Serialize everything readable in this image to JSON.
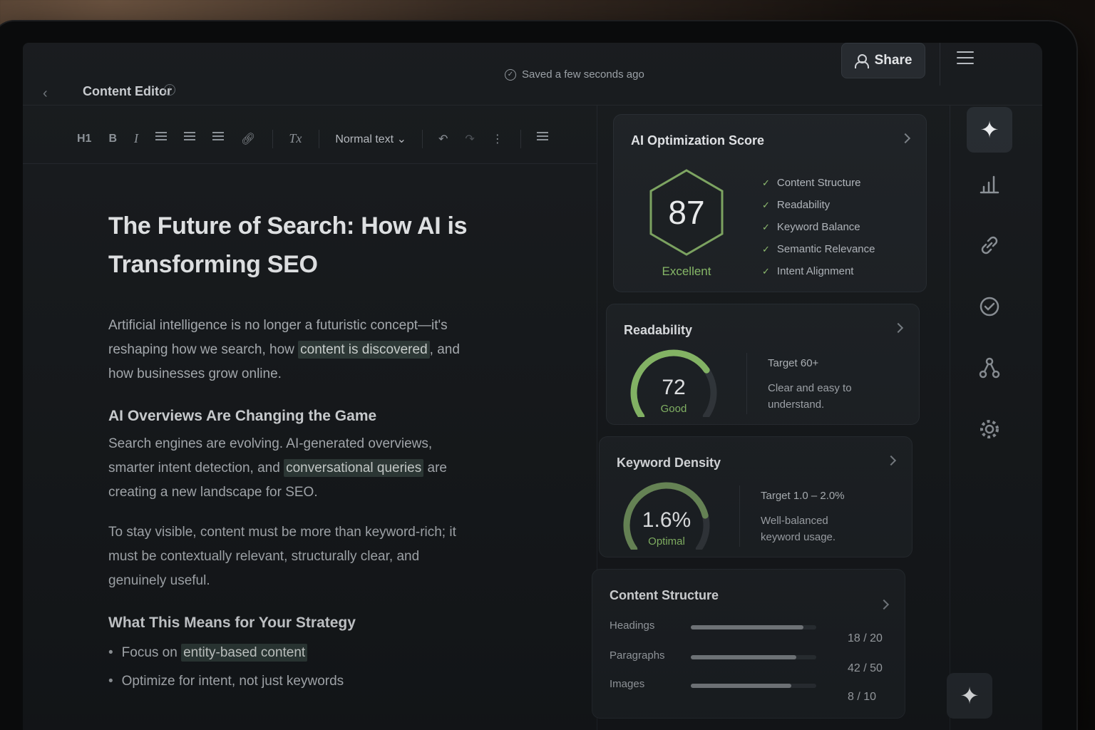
{
  "header": {
    "title": "Content Editor",
    "saved_status": "Saved a few seconds ago",
    "share_label": "Share"
  },
  "toolbar": {
    "heading": "H1",
    "bold": "B",
    "italic": "I",
    "clear_format": "Tx",
    "text_style": "Normal text",
    "more": "⋮"
  },
  "document": {
    "title": "The Future of Search: How AI is Transforming SEO",
    "intro_before": "Artificial intelligence is no longer a futuristic concept—it's reshaping how we search, how ",
    "intro_highlight": "content is discovered",
    "intro_after": ", and how businesses grow online.",
    "section1_heading": "AI Overviews Are Changing the Game",
    "section1_p1_before": "Search engines are evolving. AI-generated overviews, smarter intent detection, and ",
    "section1_p1_highlight": "conversational queries",
    "section1_p1_after": " are creating a new landscape for SEO.",
    "section1_p2": "To stay visible, content must be more than keyword-rich; it must be contextually relevant, structurally clear, and genuinely useful.",
    "section2_heading": "What This Means for Your Strategy",
    "bullet1_before": "Focus on ",
    "bullet1_highlight": "entity-based content",
    "bullet2": "Optimize for intent, not just keywords"
  },
  "score_card": {
    "title": "AI Optimization Score",
    "score": "87",
    "score_fraction": 0.87,
    "rating": "Excellent",
    "checks": [
      "Content Structure",
      "Readability",
      "Keyword Balance",
      "Semantic Relevance",
      "Intent Alignment"
    ]
  },
  "readability": {
    "title": "Readability",
    "value": "72",
    "fraction": 0.72,
    "rating": "Good",
    "target": "Target 60+",
    "description": "Clear and easy to understand."
  },
  "keyword_density": {
    "title": "Keyword Density",
    "value": "1.6%",
    "fraction": 0.8,
    "rating": "Optimal",
    "target": "Target 1.0 – 2.0%",
    "description": "Well-balanced keyword usage."
  },
  "content_structure": {
    "title": "Content Structure",
    "rows": [
      {
        "label": "Headings",
        "value": "18 / 20",
        "fraction": 0.9
      },
      {
        "label": "Paragraphs",
        "value": "42 / 50",
        "fraction": 0.84
      },
      {
        "label": "Images",
        "value": "8 / 10",
        "fraction": 0.8
      }
    ]
  },
  "colors": {
    "accent_green": "#8bbf6a",
    "background": "#15181b",
    "card": "#1c2024",
    "highlight": "#2e3a38"
  },
  "sidebar_icons": [
    "sparkle-icon",
    "bar-chart-icon",
    "link-icon",
    "check-circle-icon",
    "network-icon",
    "gear-icon",
    "sparkle-icon"
  ]
}
